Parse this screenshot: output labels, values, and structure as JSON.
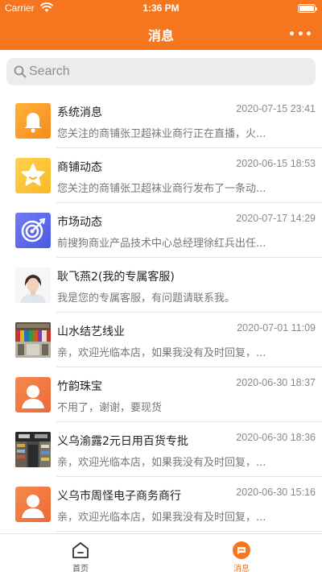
{
  "status_bar": {
    "carrier": "Carrier",
    "time": "1:36 PM"
  },
  "nav": {
    "title": "消息",
    "more_icon": "more-dots-icon"
  },
  "search": {
    "placeholder": "Search",
    "value": ""
  },
  "messages": [
    {
      "name": "系统消息",
      "time": "2020-07-15 23:41",
      "preview": "您关注的商铺张卫超袜业商行正在直播，火...",
      "avatar": "bell-icon"
    },
    {
      "name": "商铺动态",
      "time": "2020-06-15 18:53",
      "preview": "您关注的商铺张卫超袜业商行发布了一条动...",
      "avatar": "star-icon"
    },
    {
      "name": "市场动态",
      "time": "2020-07-17 14:29",
      "preview": "前搜狗商业产品技术中心总经理徐红兵出任...",
      "avatar": "target-icon"
    },
    {
      "name": "耿飞燕2(我的专属客服)",
      "time": "",
      "preview": "我是您的专属客服，有问题请联系我。",
      "avatar": "person-photo"
    },
    {
      "name": "山水结艺线业",
      "time": "2020-07-01 11:09",
      "preview": "亲，欢迎光临本店，如果我没有及时回复，...",
      "avatar": "shop-photo"
    },
    {
      "name": "竹韵珠宝",
      "time": "2020-06-30 18:37",
      "preview": "不用了，谢谢，要现货",
      "avatar": "default-user-icon"
    },
    {
      "name": "义乌渝露2元日用百货专批",
      "time": "2020-06-30 18:36",
      "preview": "亲，欢迎光临本店，如果我没有及时回复，...",
      "avatar": "store-photo"
    },
    {
      "name": "义乌市周怪电子商务商行",
      "time": "2020-06-30 15:16",
      "preview": "亲，欢迎光临本店，如果我没有及时回复，...",
      "avatar": "default-user-icon"
    }
  ],
  "tabbar": {
    "tabs": [
      {
        "label": "首页",
        "icon": "home-icon",
        "active": false
      },
      {
        "label": "消息",
        "icon": "message-icon",
        "active": true
      }
    ]
  },
  "colors": {
    "primary": "#f5761f",
    "text_inactive": "#555555"
  }
}
